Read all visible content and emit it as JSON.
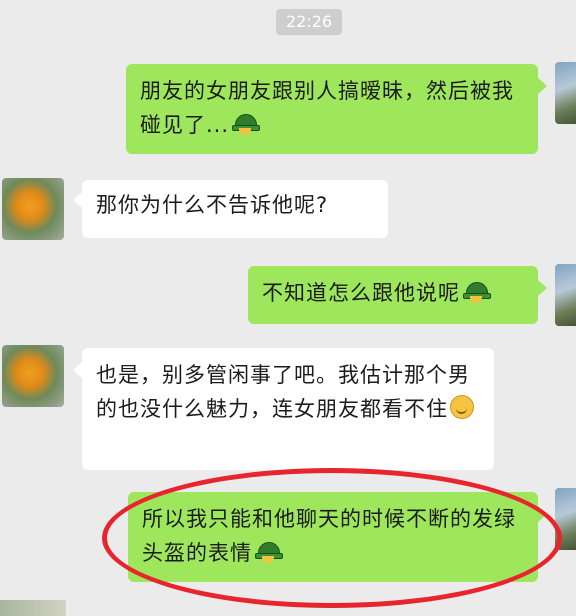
{
  "status": {
    "time": "22:26"
  },
  "messages": [
    {
      "side": "right",
      "text": "朋友的女朋友跟别人搞暧昧，然后被我碰见了...",
      "emoji": "green-hat-emoji"
    },
    {
      "side": "left",
      "text": "那你为什么不告诉他呢?"
    },
    {
      "side": "right",
      "text": "不知道怎么跟他说呢",
      "emoji": "green-hat-emoji"
    },
    {
      "side": "left",
      "text": "也是，别多管闲事了吧。我估计那个男的也没什么魅力，连女朋友都看不住",
      "emoji": "wry-smile-emoji"
    },
    {
      "side": "right",
      "text": "所以我只能和他聊天的时候不断的发绿头盔的表情",
      "emoji": "green-hat-emoji",
      "highlighted": true
    }
  ],
  "colors": {
    "outgoing_bubble": "#9ee65c",
    "incoming_bubble": "#ffffff",
    "background": "#ebebeb",
    "highlight_circle": "#e8242c"
  }
}
